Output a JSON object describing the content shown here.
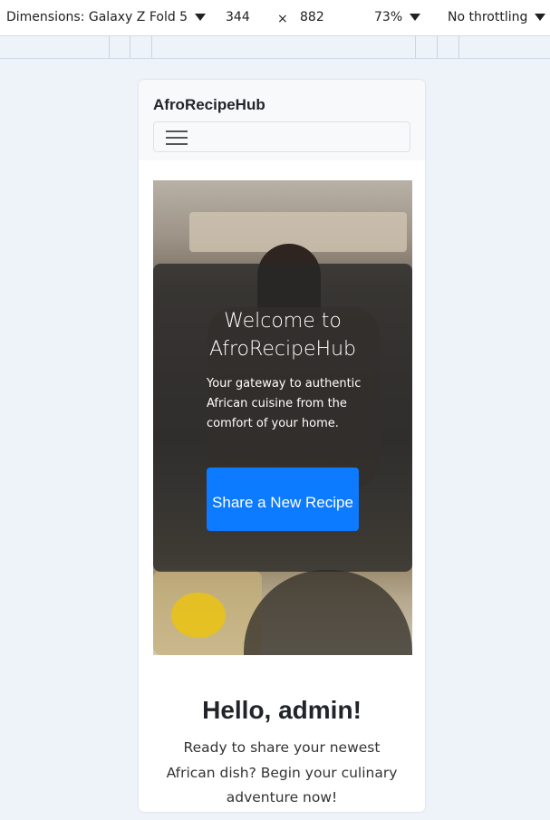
{
  "devtools": {
    "dimensions_label": "Dimensions: Galaxy Z Fold 5",
    "width": "344",
    "times": "×",
    "height": "882",
    "zoom": "73%",
    "throttling": "No throttling"
  },
  "navbar": {
    "brand": "AfroRecipeHub"
  },
  "hero": {
    "title": "Welcome to AfroRecipeHub",
    "text": "Your gateway to authentic African cuisine from the comfort of your home.",
    "button_label": "Share a New Recipe"
  },
  "greeting": {
    "title": "Hello, admin!",
    "subtitle": "Ready to share your newest African dish? Begin your culinary adventure now!"
  },
  "colors": {
    "primary_button": "#0d7bff",
    "navbar_bg": "#f8f9fa",
    "page_bg": "#eef2f9"
  }
}
